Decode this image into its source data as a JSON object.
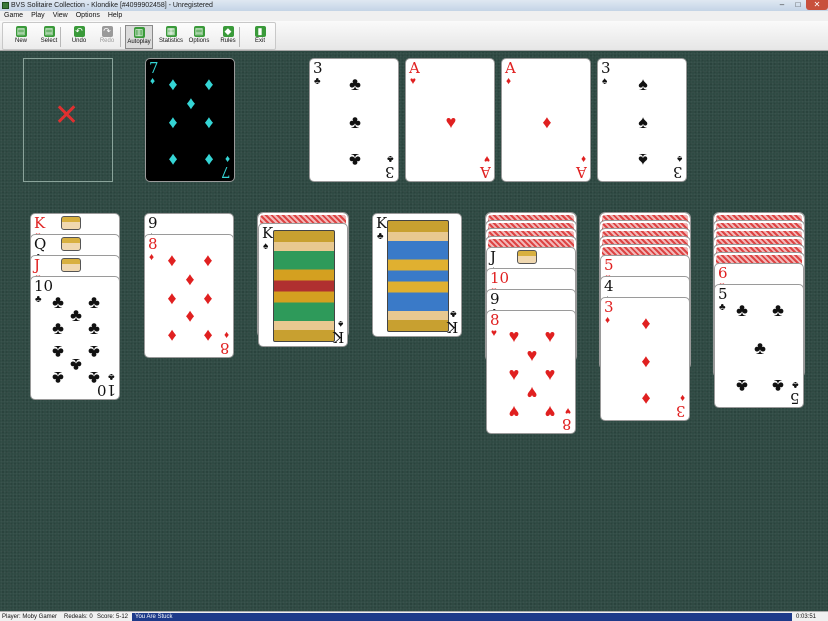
{
  "window": {
    "title": "BVS Solitaire Collection - Klondike [#4099902458] - Unregistered",
    "minimize": "–",
    "maximize": "□",
    "close": "✕"
  },
  "menu": [
    "Game",
    "Play",
    "View",
    "Options",
    "Help"
  ],
  "toolbar": [
    {
      "label": "New",
      "icon": "new-icon",
      "glyph": "▤",
      "color": "#3a9a3a"
    },
    {
      "label": "Select",
      "icon": "select-icon",
      "glyph": "▤",
      "color": "#3a9a3a"
    },
    {
      "label": "Undo",
      "icon": "undo-icon",
      "glyph": "↶",
      "color": "#3a9a3a"
    },
    {
      "label": "Redo",
      "icon": "redo-icon",
      "glyph": "↷",
      "color": "#9a9a9a"
    },
    {
      "label": "Autoplay",
      "icon": "autoplay-icon",
      "glyph": "▥",
      "color": "#3a9a3a"
    },
    {
      "label": "Statistics",
      "icon": "statistics-icon",
      "glyph": "▦",
      "color": "#3a9a3a"
    },
    {
      "label": "Options",
      "icon": "options-icon",
      "glyph": "▤",
      "color": "#3a9a3a"
    },
    {
      "label": "Rules",
      "icon": "rules-icon",
      "glyph": "◆",
      "color": "#3a9a3a"
    },
    {
      "label": "Exit",
      "icon": "exit-icon",
      "glyph": "▮",
      "color": "#3a9a3a"
    }
  ],
  "stock": {
    "empty_marker": "✕"
  },
  "waste": {
    "rank": "7",
    "suit": "♦"
  },
  "foundations": [
    {
      "rank": "3",
      "suit": "♣"
    },
    {
      "rank": "A",
      "suit": "♥"
    },
    {
      "rank": "A",
      "suit": "♦"
    },
    {
      "rank": "3",
      "suit": "♠"
    }
  ],
  "tableau": [
    {
      "face_down": 0,
      "face_up": [
        {
          "rank": "K",
          "suit": "♥"
        },
        {
          "rank": "Q",
          "suit": "♣"
        },
        {
          "rank": "J",
          "suit": "♥"
        },
        {
          "rank": "10",
          "suit": "♣"
        }
      ]
    },
    {
      "face_down": 0,
      "face_up": [
        {
          "rank": "9",
          "suit": "♠"
        },
        {
          "rank": "8",
          "suit": "♦"
        }
      ]
    },
    {
      "face_down": 1,
      "face_up": [
        {
          "rank": "K",
          "suit": "♠"
        }
      ]
    },
    {
      "face_down": 0,
      "face_up": [
        {
          "rank": "K",
          "suit": "♣"
        }
      ]
    },
    {
      "face_down": 4,
      "face_up": [
        {
          "rank": "J",
          "suit": "♠"
        },
        {
          "rank": "10",
          "suit": "♥"
        },
        {
          "rank": "9",
          "suit": "♣"
        },
        {
          "rank": "8",
          "suit": "♥"
        }
      ]
    },
    {
      "face_down": 5,
      "face_up": [
        {
          "rank": "5",
          "suit": "♥"
        },
        {
          "rank": "4",
          "suit": "♠"
        },
        {
          "rank": "3",
          "suit": "♦"
        }
      ]
    },
    {
      "face_down": 6,
      "face_up": [
        {
          "rank": "6",
          "suit": "♥"
        },
        {
          "rank": "5",
          "suit": "♣"
        }
      ]
    }
  ],
  "status": {
    "player": "Player: Moby Gamer",
    "redeals": "Redeals: 0",
    "score": "Score: 5-12",
    "message": "You Are Stuck",
    "time": "0:03:51"
  }
}
